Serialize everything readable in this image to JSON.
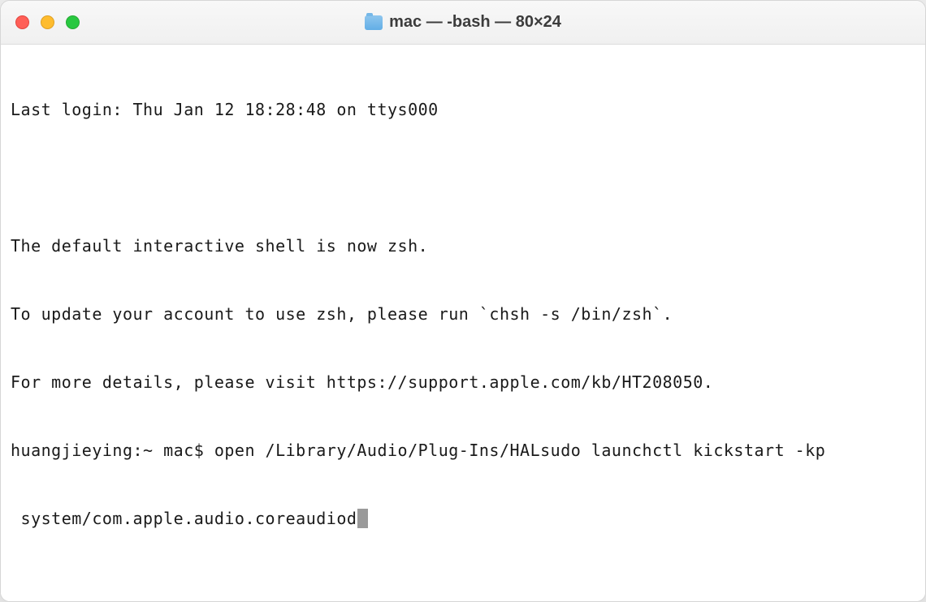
{
  "window": {
    "title": "mac — -bash — 80×24"
  },
  "terminal": {
    "last_login": "Last login: Thu Jan 12 18:28:48 on ttys000",
    "zsh_notice_1": "The default interactive shell is now zsh.",
    "zsh_notice_2": "To update your account to use zsh, please run `chsh -s /bin/zsh`.",
    "zsh_notice_3": "For more details, please visit https://support.apple.com/kb/HT208050.",
    "prompt_line": "huangjieying:~ mac$ open /Library/Audio/Plug-Ins/HALsudo launchctl kickstart -kp",
    "prompt_cont": " system/com.apple.audio.coreaudiod"
  }
}
